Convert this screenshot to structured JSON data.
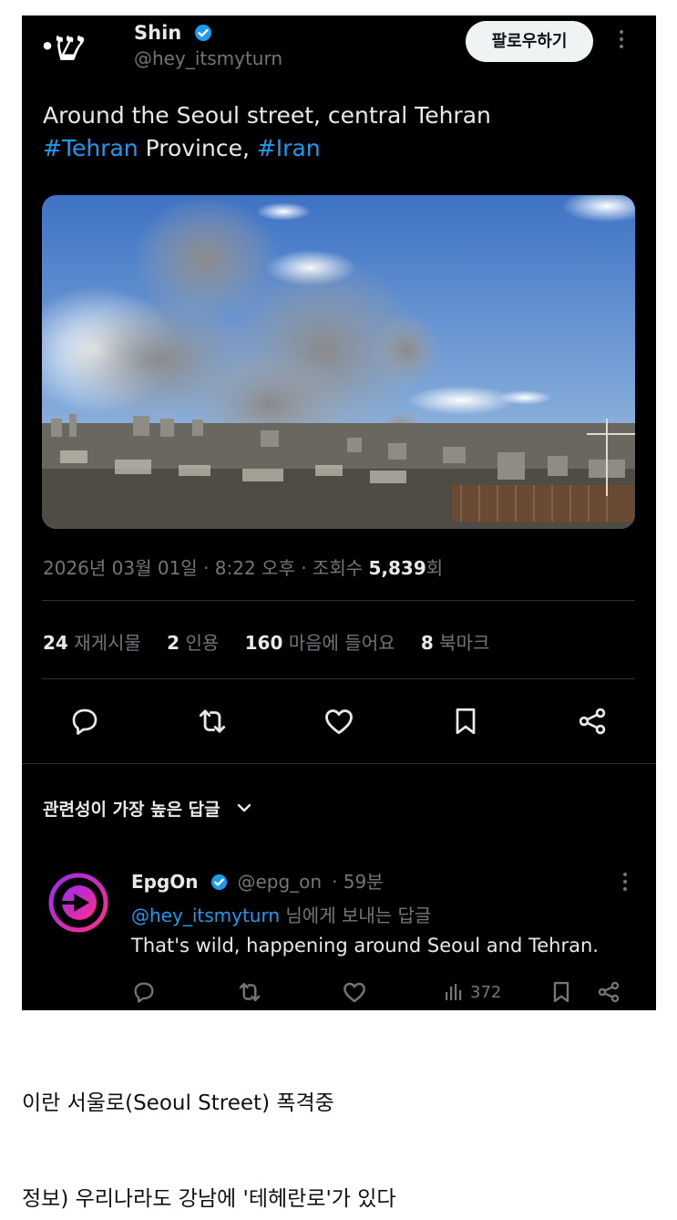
{
  "tweet": {
    "author": {
      "name": "Shin",
      "handle": "@hey_itsmyturn",
      "avatar_glyph": "·ש"
    },
    "follow_label": "팔로우하기",
    "text_line1": "Around the  Seoul street, central Tehran",
    "hashtag1": "#Tehran",
    "text_mid": " Province, ",
    "hashtag2": "#Iran",
    "timestamp_text": "2026년 03월 01일 · 8:22 오후 · 조회수 ",
    "views": "5,839",
    "views_suffix": "회",
    "stats": [
      {
        "count": "24",
        "label": "재게시물"
      },
      {
        "count": "2",
        "label": "인용"
      },
      {
        "count": "160",
        "label": "마음에 들어요"
      },
      {
        "count": "8",
        "label": "북마크"
      }
    ],
    "actions": [
      "reply-icon",
      "retweet-icon",
      "like-icon",
      "bookmark-icon",
      "share-icon"
    ]
  },
  "replies_header": "관련성이 가장 높은 답글",
  "reply": {
    "name": "EpgOn",
    "handle": "@epg_on",
    "time": "· 59분",
    "mention": "@hey_itsmyturn",
    "reply_to_suffix": " 님에게 보내는 답글",
    "text": "That's wild, happening around Seoul and Tehran.",
    "views": "372"
  },
  "captions": {
    "line1": "이란 서울로(Seoul Street) 폭격중",
    "line2": "정보) 우리나라도 강남에 '테헤란로'가 있다"
  },
  "colors": {
    "accent": "#1d9bf0",
    "background": "#000000",
    "muted": "#71767b"
  }
}
